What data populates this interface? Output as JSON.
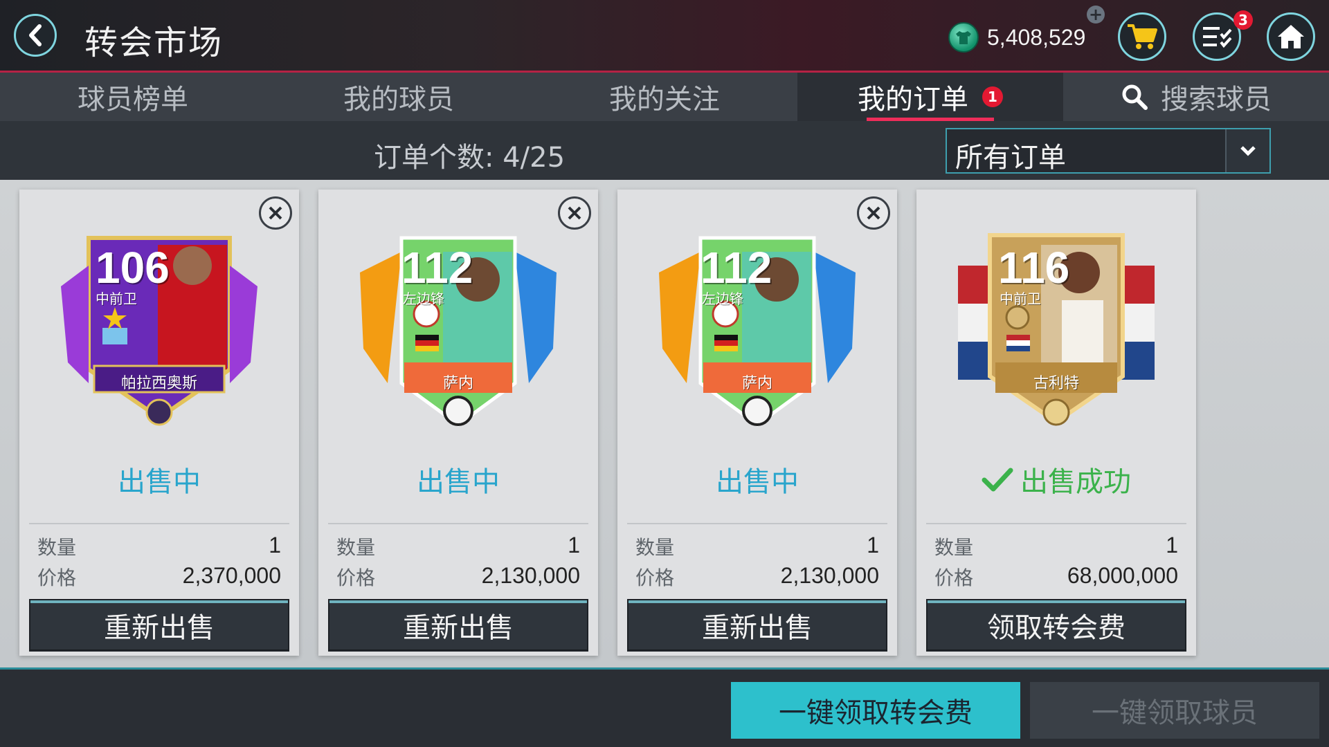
{
  "header": {
    "title": "转会市场",
    "coins": "5,408,529",
    "menu_badge": "3",
    "accent": "#7fd5df"
  },
  "tabs": [
    {
      "label": "球员榜单"
    },
    {
      "label": "我的球员"
    },
    {
      "label": "我的关注"
    },
    {
      "label": "我的订单",
      "badge": "1",
      "active": true
    },
    {
      "label": "搜索球员",
      "icon": "search-icon"
    }
  ],
  "orders": {
    "count_label": "订单个数: 4/25",
    "filter_value": "所有订单"
  },
  "cards": [
    {
      "rating": "106",
      "position": "中前卫",
      "name": "帕拉西奥斯",
      "status": "出售中",
      "qty_label": "数量",
      "qty": "1",
      "price_label": "价格",
      "price": "2,370,000",
      "button": "重新出售"
    },
    {
      "rating": "112",
      "position": "左边锋",
      "name": "萨内",
      "status": "出售中",
      "qty_label": "数量",
      "qty": "1",
      "price_label": "价格",
      "price": "2,130,000",
      "button": "重新出售"
    },
    {
      "rating": "112",
      "position": "左边锋",
      "name": "萨内",
      "status": "出售中",
      "qty_label": "数量",
      "qty": "1",
      "price_label": "价格",
      "price": "2,130,000",
      "button": "重新出售"
    },
    {
      "rating": "116",
      "position": "中前卫",
      "name": "古利特",
      "status": "出售成功",
      "qty_label": "数量",
      "qty": "1",
      "price_label": "价格",
      "price": "68,000,000",
      "button": "领取转会费"
    }
  ],
  "bottom": {
    "claim_fees": "一键领取转会费",
    "claim_players": "一键领取球员"
  }
}
